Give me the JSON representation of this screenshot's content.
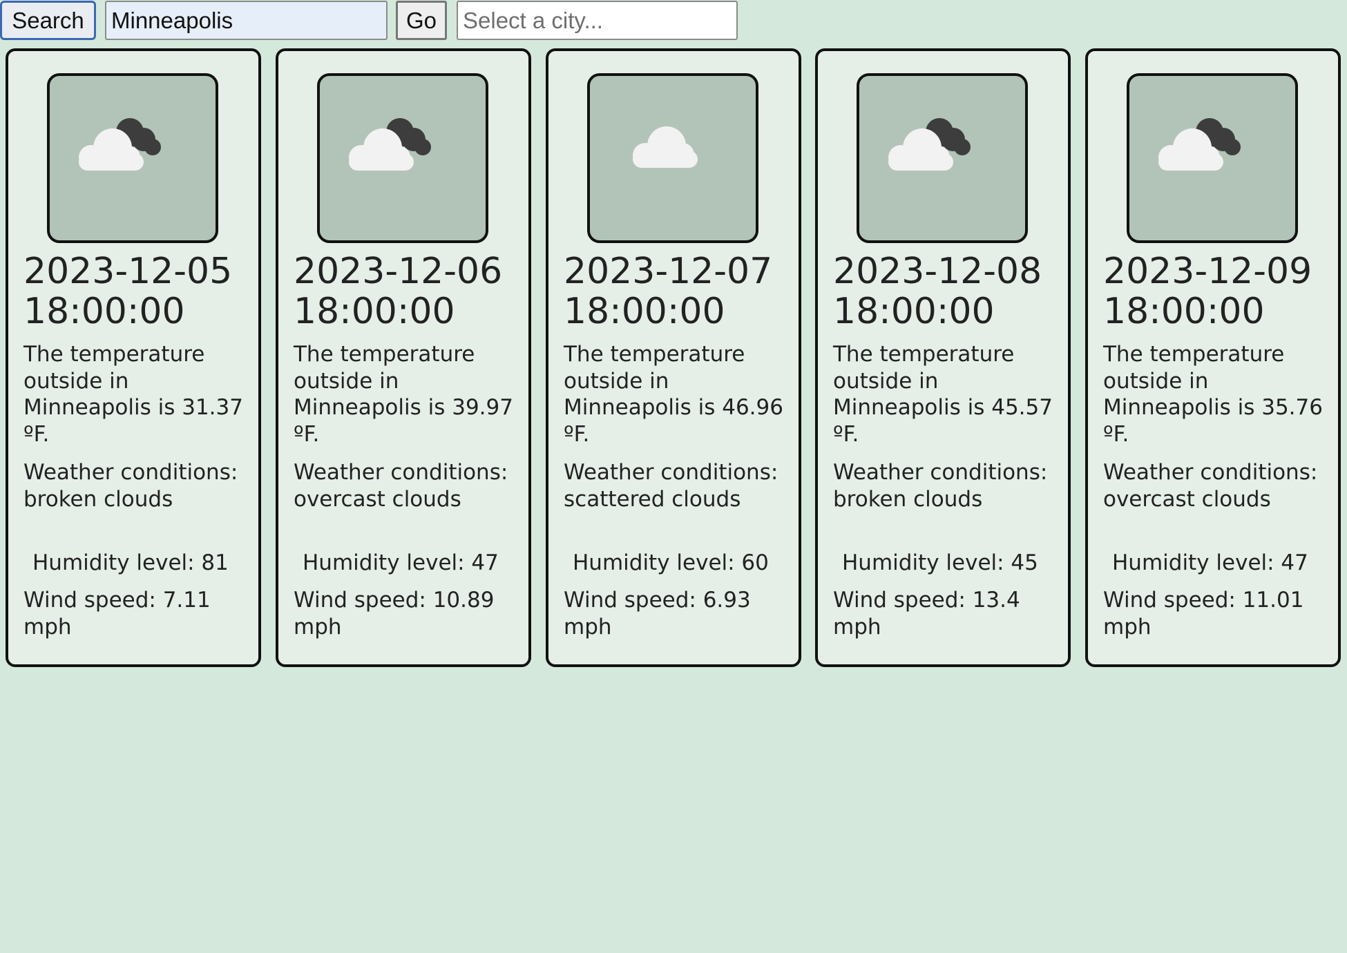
{
  "toolbar": {
    "search_label": "Search",
    "city_input_value": "Minneapolis",
    "go_label": "Go",
    "select_placeholder": "Select a city..."
  },
  "cards": [
    {
      "date": "2023-12-05",
      "time": "18:00:00",
      "temperature": "The temperature outside in Minneapolis is 31.37 ºF.",
      "conditions": "Weather conditions: broken clouds",
      "humidity": "Humidity level: 81",
      "wind": "Wind speed: 7.11 mph",
      "icon": "broken-clouds-icon"
    },
    {
      "date": "2023-12-06",
      "time": "18:00:00",
      "temperature": "The temperature outside in Minneapolis is 39.97 ºF.",
      "conditions": "Weather conditions: overcast clouds",
      "humidity": "Humidity level: 47",
      "wind": "Wind speed: 10.89 mph",
      "icon": "overcast-clouds-icon"
    },
    {
      "date": "2023-12-07",
      "time": "18:00:00",
      "temperature": "The temperature outside in Minneapolis is 46.96 ºF.",
      "conditions": "Weather conditions: scattered clouds",
      "humidity": "Humidity level: 60",
      "wind": "Wind speed: 6.93 mph",
      "icon": "scattered-clouds-icon"
    },
    {
      "date": "2023-12-08",
      "time": "18:00:00",
      "temperature": "The temperature outside in Minneapolis is 45.57 ºF.",
      "conditions": "Weather conditions: broken clouds",
      "humidity": "Humidity level: 45",
      "wind": "Wind speed: 13.4 mph",
      "icon": "broken-clouds-icon"
    },
    {
      "date": "2023-12-09",
      "time": "18:00:00",
      "temperature": "The temperature outside in Minneapolis is 35.76 ºF.",
      "conditions": "Weather conditions: overcast clouds",
      "humidity": "Humidity level: 47",
      "wind": "Wind speed: 11.01 mph",
      "icon": "overcast-clouds-icon"
    }
  ],
  "colors": {
    "page_background": "#d4e9dc",
    "card_background": "#e5efe8",
    "icon_background": "#b2c4b8",
    "cloud_light": "#f2f2f2",
    "cloud_dark": "#3d3d3d",
    "search_button_border": "#3c68b4",
    "city_input_background": "#e6eefa"
  }
}
